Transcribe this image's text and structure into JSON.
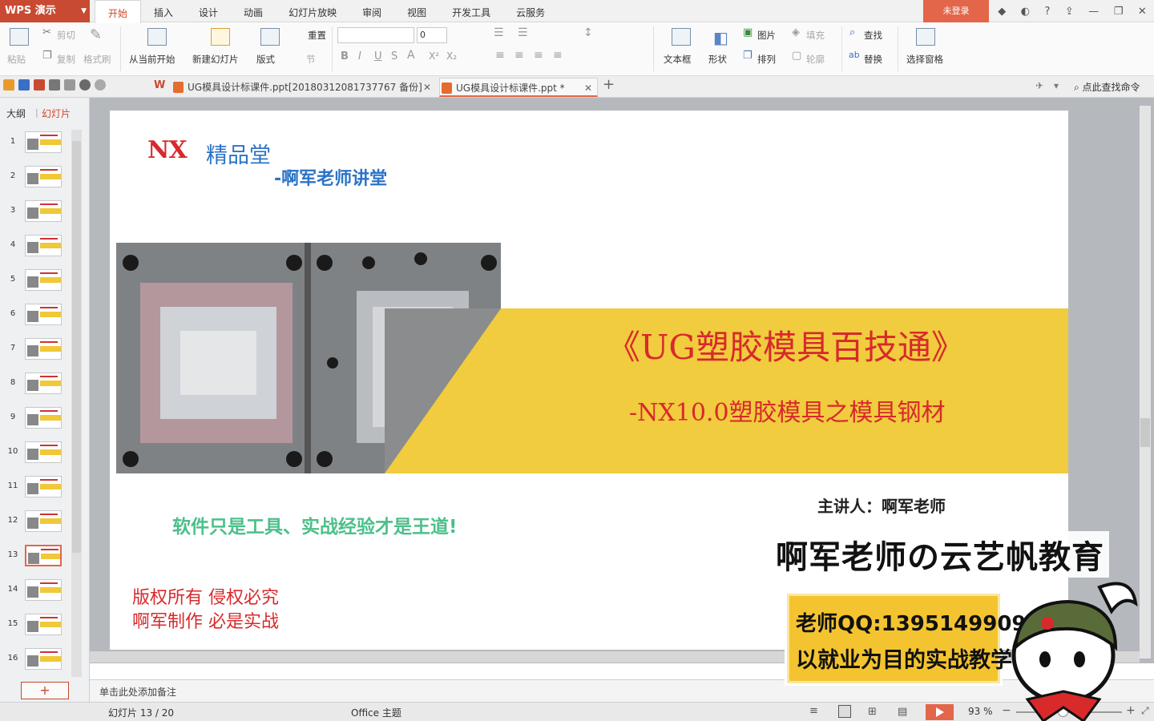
{
  "app": {
    "logo": "WPS 演示",
    "login": "未登录"
  },
  "menu_tabs": [
    "开始",
    "插入",
    "设计",
    "动画",
    "幻灯片放映",
    "审阅",
    "视图",
    "开发工具",
    "云服务"
  ],
  "ribbon": {
    "paste": "粘贴",
    "cut": "剪切",
    "copy": "复制",
    "format_brush": "格式刷",
    "from_current": "从当前开始",
    "new_slide": "新建幻灯片",
    "layout": "版式",
    "reset": "重置",
    "section": "节",
    "font_size": "0",
    "textbox": "文本框",
    "shape": "形状",
    "picture": "图片",
    "fill": "填充",
    "arrange": "排列",
    "outline": "轮廓",
    "find": "查找",
    "replace": "替换",
    "select_pane": "选择窗格"
  },
  "doc_tabs": [
    {
      "title": "UG模具设计标课件.ppt[20180312081737767 备份]"
    },
    {
      "title": "UG模具设计标课件.ppt *"
    }
  ],
  "find_command": "点此查找命令",
  "left_panel": {
    "outline_tab": "大纲",
    "slides_tab": "幻灯片"
  },
  "thumbnails": [
    "1",
    "2",
    "3",
    "4",
    "5",
    "6",
    "7",
    "8",
    "9",
    "10",
    "11",
    "12",
    "13",
    "14",
    "15",
    "16"
  ],
  "active_slide": 13,
  "slide": {
    "logo": "NX",
    "brand": "精品堂",
    "subtitle": "-啊军老师讲堂",
    "main_title": "《UG塑胶模具百技通》",
    "sub_title": "-NX10.0塑胶模具之模具钢材",
    "presenter": "主讲人：啊军老师",
    "slogan": "软件只是工具、实战经验才是王道!",
    "copyright_1": "版权所有    侵权必究",
    "copyright_2": "啊军制作    必是实战"
  },
  "notes_placeholder": "单击此处添加备注",
  "status": {
    "slide_counter": "幻灯片 13 / 20",
    "theme": "Office 主题",
    "zoom": "93 %"
  },
  "watermark": {
    "title": "啊军老师の云艺帆教育",
    "qq": "老师QQ:1395149909",
    "tagline": "以就业为目的实战教学"
  },
  "colors": {
    "accent": "#e3664a",
    "slide_red": "#d8292b",
    "slide_blue": "#2c73c7",
    "slide_yellow": "#f0cc3e",
    "slogan_green": "#4cc08a"
  }
}
